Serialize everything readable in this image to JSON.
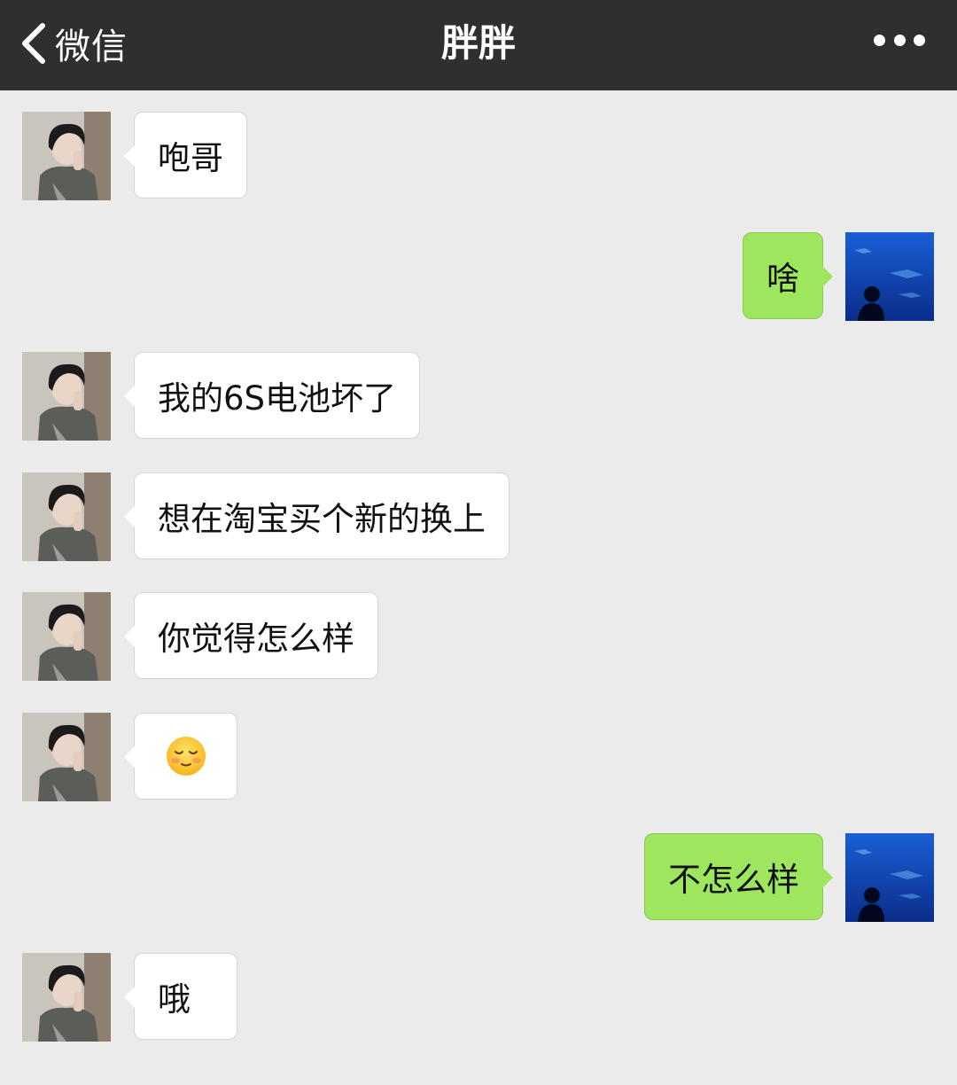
{
  "nav": {
    "back_label": "微信",
    "title": "胖胖",
    "more_icon": "more-dots-icon",
    "back_icon": "chevron-left-icon"
  },
  "colors": {
    "navbar": "#2f2f31",
    "background": "#ebebeb",
    "outgoing_bubble": "#9ee65e",
    "incoming_bubble": "#ffffff"
  },
  "messages": [
    {
      "side": "in",
      "text": "咆哥"
    },
    {
      "side": "out",
      "text": "啥"
    },
    {
      "side": "in",
      "text": "我的6S电池坏了"
    },
    {
      "side": "in",
      "text": "想在淘宝买个新的换上"
    },
    {
      "side": "in",
      "text": "你觉得怎么样"
    },
    {
      "side": "in",
      "emoji": "smiling-face-emoji"
    },
    {
      "side": "out",
      "text": "不怎么样"
    },
    {
      "side": "in",
      "text": "哦"
    }
  ]
}
